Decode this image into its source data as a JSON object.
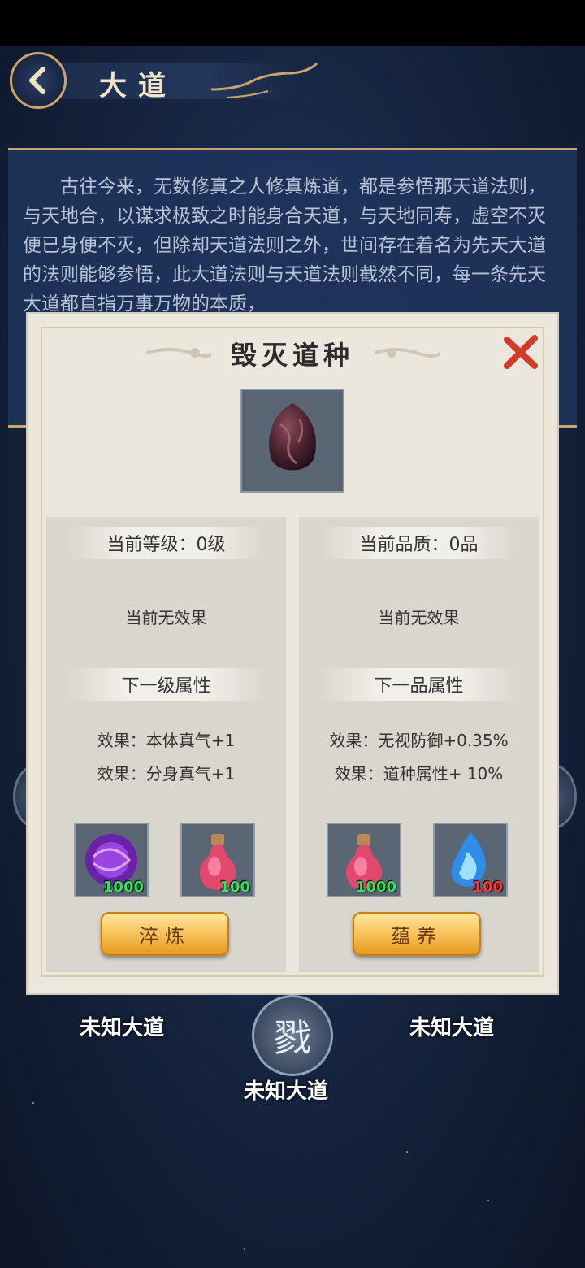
{
  "header": {
    "title": "大道"
  },
  "intro": {
    "text": "古往今来，无数修真之人修真炼道，都是参悟那天道法则，与天地合，以谋求极致之时能身合天道，与天地同寿，虚空不灭便已身便不灭，但除却天道法则之外，世间存在着名为先天大道的法则能够参悟，此大道法则与天道法则截然不同，每一条先天大道都直指万事万物的本质，"
  },
  "background": {
    "labels": [
      "未知大道",
      "未知大道",
      "未知大道"
    ],
    "center_glyph": "戮"
  },
  "dialog": {
    "title": "毁灭道种",
    "icons": {
      "close": "close-icon",
      "item": "seed-icon"
    },
    "left": {
      "current_label": "当前等级：0级",
      "current_effect": "当前无效果",
      "next_label": "下一级属性",
      "effects": [
        "效果：本体真气+1",
        "效果：分身真气+1"
      ],
      "materials": [
        {
          "icon": "purple-orb-icon",
          "count": "1000",
          "count_color": "#37e05a"
        },
        {
          "icon": "pink-potion-icon",
          "count": "100",
          "count_color": "#37e05a"
        }
      ],
      "button": "淬炼"
    },
    "right": {
      "current_label": "当前品质：0品",
      "current_effect": "当前无效果",
      "next_label": "下一品属性",
      "effects": [
        "效果：无视防御+0.35%",
        "效果：道种属性+ 10%"
      ],
      "materials": [
        {
          "icon": "pink-potion-icon",
          "count": "1000",
          "count_color": "#37e05a"
        },
        {
          "icon": "blue-flame-icon",
          "count": "100",
          "count_color": "#ff3a3a"
        }
      ],
      "button": "蕴养"
    }
  }
}
